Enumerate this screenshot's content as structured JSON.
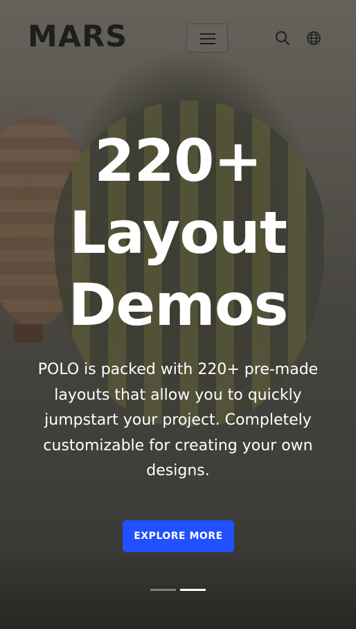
{
  "header": {
    "logo": "MARS",
    "menu_icon": "hamburger-icon",
    "search_icon": "search-icon",
    "language_icon": "globe-icon"
  },
  "hero": {
    "title_lines": [
      "220+",
      "Layout",
      "Demos"
    ],
    "description": "POLO is packed with 220+ pre-made layouts that allow you to quickly jumpstart your project. Completely customizable for creating your own designs.",
    "cta_label": "EXPLORE MORE",
    "slides": {
      "total": 2,
      "active": 2
    }
  },
  "colors": {
    "accent": "#2250fc",
    "logo": "#1e1e1e",
    "hero_text": "#ffffff"
  }
}
